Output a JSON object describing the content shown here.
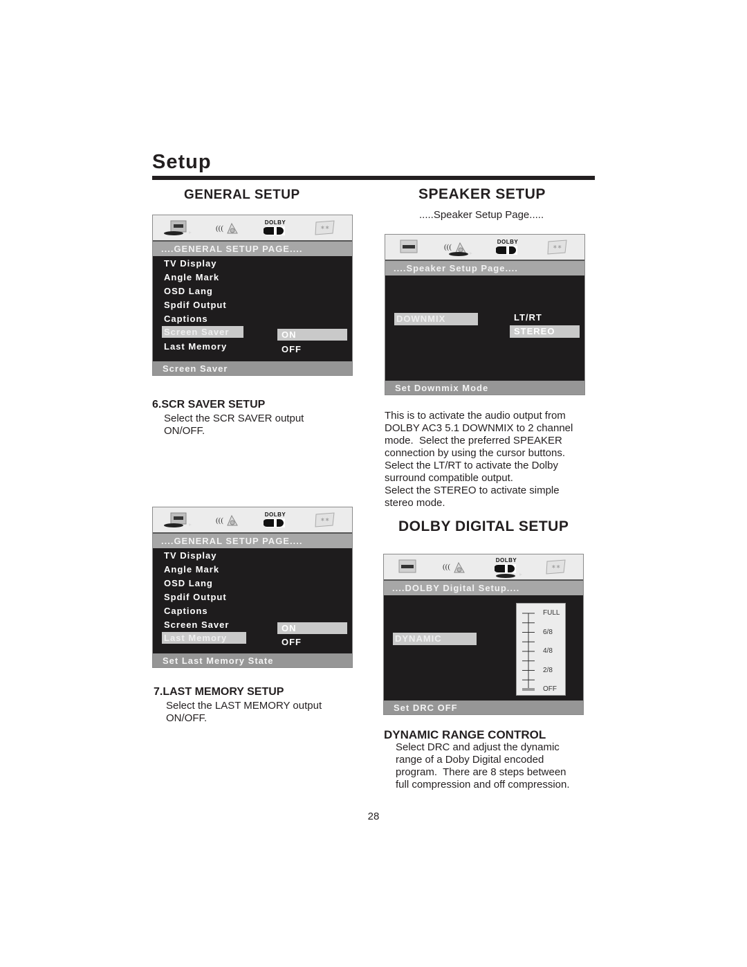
{
  "page": {
    "title": "Setup",
    "page_number": "28"
  },
  "general_setup": {
    "heading": "GENERAL SETUP",
    "screen1": {
      "icon_bar": [
        "tv-display-icon",
        "speaker-icon",
        "dolby-icon",
        "preference-icon"
      ],
      "dolby_label": "DOLBY",
      "page_bar": "....GENERAL SETUP PAGE....",
      "items": [
        "TV Display",
        "Angle Mark",
        "OSD Lang",
        "Spdif Output",
        "Captions",
        "Screen Saver",
        "Last Memory"
      ],
      "selected_item": "Screen Saver",
      "options": [
        "ON",
        "OFF"
      ],
      "selected_option": "ON",
      "status": "Screen Saver"
    },
    "scr_saver": {
      "heading": "6.SCR SAVER SETUP",
      "text_line1": "Select the SCR SAVER output",
      "text_line2": "ON/OFF."
    },
    "screen2": {
      "dolby_label": "DOLBY",
      "page_bar": "....GENERAL SETUP PAGE....",
      "items": [
        "TV Display",
        "Angle Mark",
        "OSD Lang",
        "Spdif Output",
        "Captions",
        "Screen Saver",
        "Last Memory"
      ],
      "selected_item": "Last Memory",
      "options": [
        "ON",
        "OFF"
      ],
      "selected_option": "ON",
      "status": "Set Last Memory State"
    },
    "last_memory": {
      "heading": "7.LAST MEMORY SETUP",
      "text_line1": "Select the LAST MEMORY output",
      "text_line2": "ON/OFF."
    }
  },
  "speaker_setup": {
    "heading": "SPEAKER SETUP",
    "caption": ".....Speaker Setup Page.....",
    "screen": {
      "dolby_label": "DOLBY",
      "page_bar": "....Speaker Setup Page....",
      "item": "DOWNMIX",
      "options": [
        "LT/RT",
        "STEREO"
      ],
      "selected_option": "STEREO",
      "status": "Set Downmix Mode"
    },
    "description": [
      "This is to activate the audio output from",
      "DOLBY AC3 5.1 DOWNMIX to 2 channel",
      "mode.  Select the preferred SPEAKER",
      "connection by using the cursor buttons.",
      "Select the LT/RT to activate the Dolby",
      "surround compatible output.",
      "Select the STEREO to activate simple",
      "stereo mode."
    ]
  },
  "dolby_digital_setup": {
    "heading": "DOLBY DIGITAL SETUP",
    "screen": {
      "dolby_label": "DOLBY",
      "page_bar": "....DOLBY Digital Setup....",
      "item": "DYNAMIC",
      "scale_labels": [
        "FULL",
        "6/8",
        "4/8",
        "2/8",
        "OFF"
      ],
      "scale_steps": 8,
      "current_level": "OFF",
      "status": "Set DRC OFF"
    },
    "drc": {
      "heading": "DYNAMIC RANGE CONTROL",
      "lines": [
        "Select DRC and adjust the dynamic",
        "range of a Doby Digital encoded",
        "program.  There are 8 steps between",
        "full compression and off compression."
      ]
    }
  }
}
